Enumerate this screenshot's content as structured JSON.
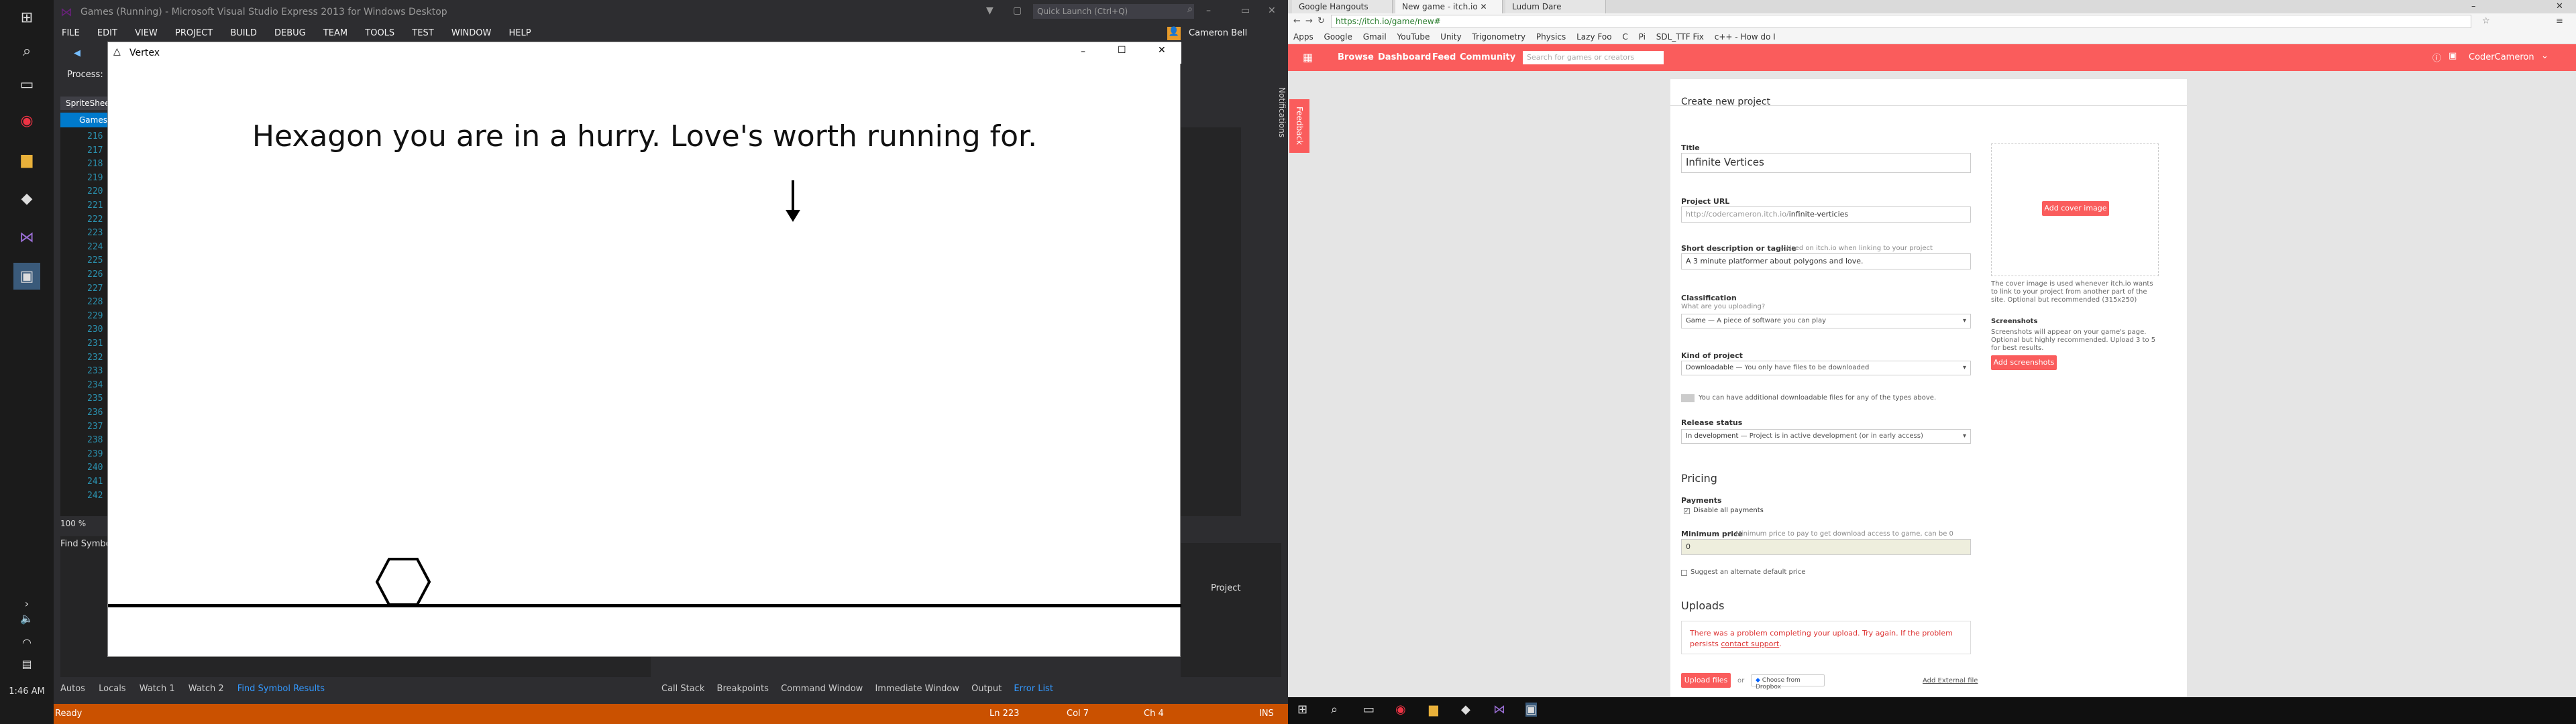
{
  "left_taskbar": {
    "clock": "1:46 AM"
  },
  "vs": {
    "title": "Games (Running) - Microsoft Visual Studio Express 2013 for Windows Desktop",
    "quick_launch_placeholder": "Quick Launch (Ctrl+Q)",
    "user": "Cameron Bell",
    "menu": [
      "FILE",
      "EDIT",
      "VIEW",
      "PROJECT",
      "BUILD",
      "DEBUG",
      "TEAM",
      "TOOLS",
      "TEST",
      "WINDOW",
      "HELP"
    ],
    "process_label": "Process:",
    "spritesheet_tab": "SpriteSheet",
    "games_tab": "Games",
    "line_numbers": [
      "216",
      "217",
      "218",
      "219",
      "220",
      "221",
      "222",
      "223",
      "224",
      "225",
      "226",
      "227",
      "228",
      "229",
      "230",
      "231",
      "232",
      "233",
      "234",
      "235",
      "236",
      "237",
      "238",
      "239",
      "240",
      "241",
      "242"
    ],
    "zoom": "100 %",
    "find_symbol_title": "Find Symbol",
    "notifications": "Notifications",
    "project_label": "Project",
    "bottom_tabs_left": [
      "Autos",
      "Locals",
      "Watch 1",
      "Watch 2",
      "Find Symbol Results"
    ],
    "bottom_tabs_right": [
      "Call Stack",
      "Breakpoints",
      "Command Window",
      "Immediate Window",
      "Output",
      "Error List"
    ],
    "status": {
      "ready": "Ready",
      "ln": "Ln 223",
      "col": "Col 7",
      "ch": "Ch 4",
      "ins": "INS"
    }
  },
  "game": {
    "title": "Vertex",
    "text": "Hexagon you are in a hurry. Love's worth running for."
  },
  "chrome": {
    "tabs": [
      "Google Hangouts",
      "New game - itch.io",
      "Ludum Dare"
    ],
    "url": "https://itch.io/game/new#",
    "bookmarks": [
      "Apps",
      "Google",
      "Gmail",
      "YouTube",
      "Unity",
      "Trigonometry",
      "Physics",
      "Lazy Foo",
      "C",
      "Pi",
      "SDL_TTF Fix",
      "c++ - How do I"
    ]
  },
  "itch": {
    "nav": [
      "Browse",
      "Dashboard",
      "Feed",
      "Community"
    ],
    "search_placeholder": "Search for games or creators",
    "user": "CoderCameron",
    "feedback": "Feedback",
    "page_title": "Create new project",
    "title_label": "Title",
    "title_value": "Infinite Vertices",
    "url_label": "Project URL",
    "url_prefix": "http://codercameron.itch.io/",
    "url_value": "infinite-verticies",
    "desc_label": "Short description or tagline",
    "desc_hint": "— Used on itch.io when linking to your project",
    "desc_value": "A 3 minute platformer about polygons and love.",
    "class_label": "Classification",
    "class_sub": "What are you uploading?",
    "class_value": "Game",
    "class_hint": "— A piece of software you can play",
    "kind_label": "Kind of project",
    "kind_value": "Downloadable",
    "kind_hint": "— You only have files to be downloaded",
    "kind_note": "You can have additional downloadable files for any of the types above.",
    "release_label": "Release status",
    "release_value": "In development",
    "release_hint": "— Project is in active development (or in early access)",
    "pricing": "Pricing",
    "payments_label": "Payments",
    "disable_payments": "Disable all payments",
    "min_price_label": "Minimum price",
    "min_price_hint": "— Minimum price to pay to get download access to game, can be 0",
    "min_price_value": "0",
    "suggest_default": "Suggest an alternate default price",
    "uploads": "Uploads",
    "upload_error": "There was a problem completing your upload. Try again. If the problem persists",
    "contact_support": "contact support",
    "upload_files": "Upload files",
    "or": "or",
    "dropbox": "Choose from Dropbox",
    "external": "Add External file",
    "cover_button": "Add cover image",
    "cover_note": "The cover image is used whenever itch.io wants to link to your project from another part of the site. Optional but recommended (315x250)",
    "screenshots_label": "Screenshots",
    "screenshots_note": "Screenshots will appear on your game's page. Optional but highly recommended. Upload 3 to 5 for best results.",
    "add_screenshots": "Add screenshots"
  }
}
